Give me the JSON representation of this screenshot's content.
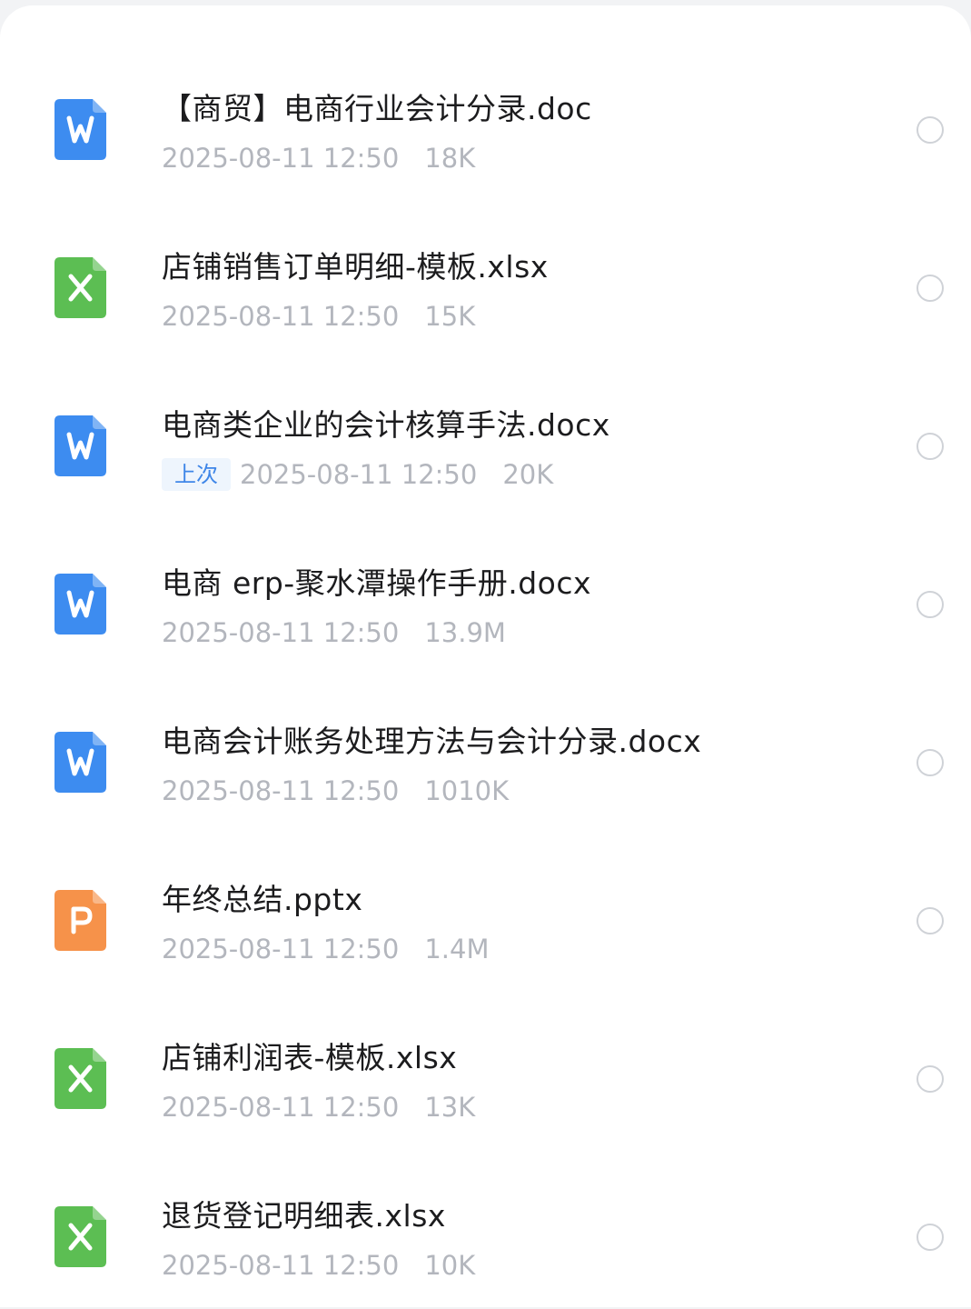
{
  "colors": {
    "doc": "#3d8cf0",
    "xls": "#5cbe53",
    "ppt": "#f6924a"
  },
  "files": [
    {
      "name": "【商贸】电商行业会计分录.doc",
      "date": "2025-08-11 12:50",
      "size": "18K",
      "type": "doc",
      "icon": "word-file-icon",
      "badge": ""
    },
    {
      "name": "店铺销售订单明细-模板.xlsx",
      "date": "2025-08-11 12:50",
      "size": "15K",
      "type": "xls",
      "icon": "excel-file-icon",
      "badge": ""
    },
    {
      "name": "电商类企业的会计核算手法.docx",
      "date": "2025-08-11 12:50",
      "size": "20K",
      "type": "doc",
      "icon": "word-file-icon",
      "badge": "上次"
    },
    {
      "name": "电商 erp-聚水潭操作手册.docx",
      "date": "2025-08-11 12:50",
      "size": "13.9M",
      "type": "doc",
      "icon": "word-file-icon",
      "badge": ""
    },
    {
      "name": "电商会计账务处理方法与会计分录.docx",
      "date": "2025-08-11 12:50",
      "size": "1010K",
      "type": "doc",
      "icon": "word-file-icon",
      "badge": ""
    },
    {
      "name": "年终总结.pptx",
      "date": "2025-08-11 12:50",
      "size": "1.4M",
      "type": "ppt",
      "icon": "powerpoint-file-icon",
      "badge": ""
    },
    {
      "name": "店铺利润表-模板.xlsx",
      "date": "2025-08-11 12:50",
      "size": "13K",
      "type": "xls",
      "icon": "excel-file-icon",
      "badge": ""
    },
    {
      "name": "退货登记明细表.xlsx",
      "date": "2025-08-11 12:50",
      "size": "10K",
      "type": "xls",
      "icon": "excel-file-icon",
      "badge": ""
    }
  ]
}
